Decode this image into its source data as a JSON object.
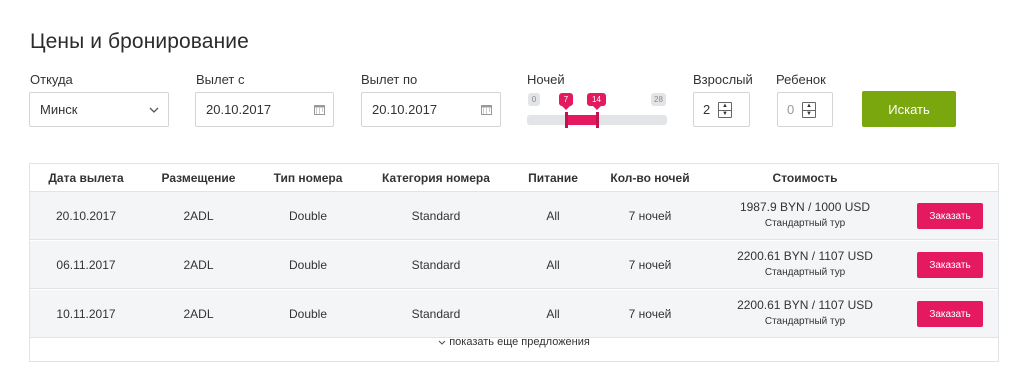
{
  "page": {
    "title": "Цены и бронирование"
  },
  "form": {
    "from": {
      "label": "Откуда",
      "value": "Минск"
    },
    "date_from": {
      "label": "Вылет с",
      "value": "20.10.2017"
    },
    "date_to": {
      "label": "Вылет по",
      "value": "20.10.2017"
    },
    "nights": {
      "label": "Ночей",
      "min": "0",
      "max": "28",
      "selected_from": "7",
      "selected_to": "14"
    },
    "adults": {
      "label": "Взрослый",
      "value": "2"
    },
    "children": {
      "label": "Ребенок",
      "value": "0"
    },
    "search_label": "Искать"
  },
  "table": {
    "columns": [
      "Дата вылета",
      "Размещение",
      "Тип номера",
      "Категория номера",
      "Питание",
      "Кол-во ночей",
      "Стоимость"
    ],
    "rows": [
      {
        "date": "20.10.2017",
        "placement": "2ADL",
        "room_type": "Double",
        "category": "Standard",
        "meal": "All",
        "nights": "7 ночей",
        "price": "1987.9 BYN / 1000 USD",
        "tour": "Стандартный тур",
        "order_label": "Заказать"
      },
      {
        "date": "06.11.2017",
        "placement": "2ADL",
        "room_type": "Double",
        "category": "Standard",
        "meal": "All",
        "nights": "7 ночей",
        "price": "2200.61 BYN / 1107 USD",
        "tour": "Стандартный тур",
        "order_label": "Заказать"
      },
      {
        "date": "10.11.2017",
        "placement": "2ADL",
        "room_type": "Double",
        "category": "Standard",
        "meal": "All",
        "nights": "7 ночей",
        "price": "2200.61 BYN / 1107 USD",
        "tour": "Стандартный тур",
        "order_label": "Заказать"
      }
    ],
    "more_label": "показать еще предложения"
  },
  "icons": {
    "dropdown": "chevron-down-icon",
    "calendar": "calendar-icon",
    "spinner": "stepper-icon",
    "more": "chevron-down-icon"
  },
  "colors": {
    "accent_pink": "#e5195f",
    "search_green": "#7aa70e",
    "row_bg": "#f4f5f7"
  }
}
